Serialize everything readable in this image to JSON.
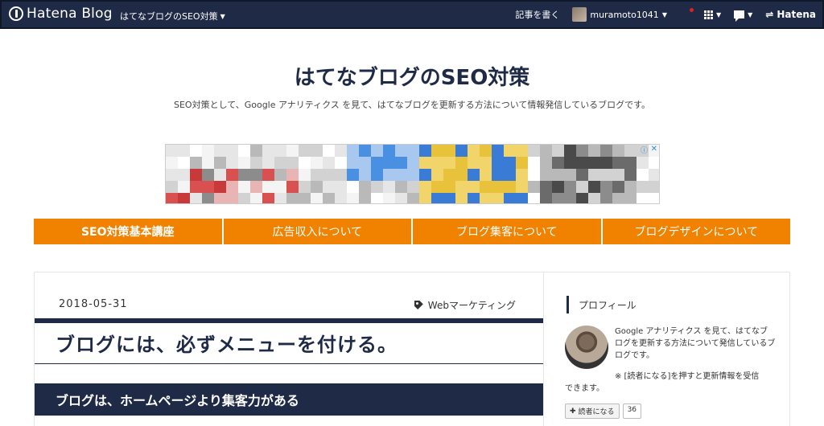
{
  "topbar": {
    "logo_text": "Hatena Blog",
    "blog_menu": "はてなブログのSEO対策",
    "write_label": "記事を書く",
    "username": "muramoto1041",
    "hatena_label": "Hatena"
  },
  "header": {
    "title": "はてなブログのSEO対策",
    "description": "SEO対策として、Google アナリティクス を見て、はてなブログを更新する方法について情報発信しているブログです。"
  },
  "nav": {
    "items": [
      "SEO対策基本講座",
      "広告収入について",
      "ブログ集客について",
      "ブログデザインについて"
    ]
  },
  "entry": {
    "date": "2018-05-31",
    "category": "Webマーケティング",
    "title": "ブログには、必ずメニューを付ける。",
    "h2": "ブログは、ホームページより集客力がある"
  },
  "sidebar": {
    "heading": "プロフィール",
    "profile_text": "Google アナリティクス を見て、はてなブログを更新する方法について発信しているブログです。",
    "note_line1": "※ [読者になる]を押すと更新情報を受信",
    "note_line2": "できます。",
    "subscribe_label": "読者になる",
    "subscriber_count": "36"
  },
  "colors": {
    "navy": "#1f2b46",
    "orange": "#f18200"
  }
}
